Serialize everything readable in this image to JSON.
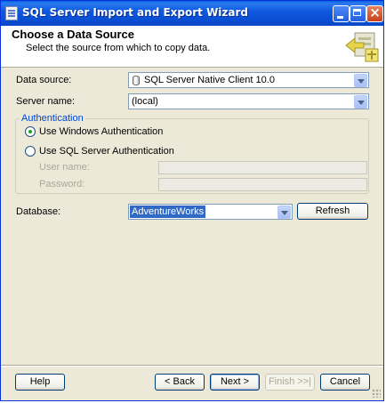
{
  "window": {
    "title": "SQL Server Import and Export Wizard"
  },
  "header": {
    "title": "Choose a Data Source",
    "subtitle": "Select the source from which to copy data."
  },
  "form": {
    "data_source_label": "Data source:",
    "data_source_value": "SQL Server Native Client 10.0",
    "server_name_label": "Server name:",
    "server_name_value": "(local)",
    "auth_group_label": "Authentication",
    "auth_windows_label": "Use Windows Authentication",
    "auth_sql_label": "Use SQL Server Authentication",
    "auth_selected": "windows",
    "user_name_label": "User name:",
    "password_label": "Password:",
    "database_label": "Database:",
    "database_value": "AdventureWorks",
    "refresh_label": "Refresh"
  },
  "footer": {
    "help_label": "Help",
    "back_label": "< Back",
    "next_label": "Next >",
    "finish_label": "Finish >>|",
    "cancel_label": "Cancel"
  },
  "colors": {
    "titlebar": "#0a4fd4",
    "legend": "#0046d5",
    "selection": "#316ac5",
    "face": "#ece9d8"
  }
}
